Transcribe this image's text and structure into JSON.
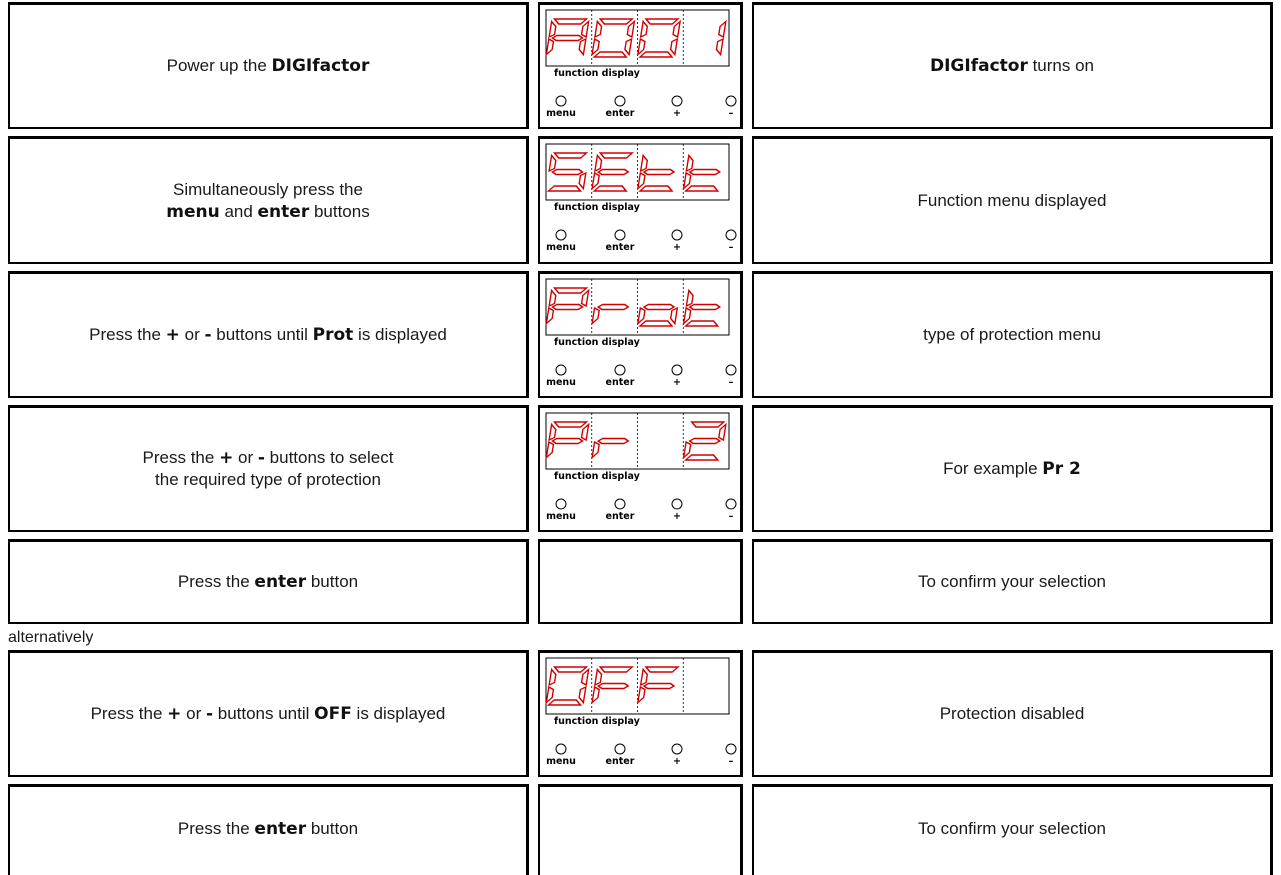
{
  "rows": [
    {
      "left": {
        "pre": "Power up the ",
        "b1": "DIGIfactor",
        "mid": "",
        "b2": "",
        "post": ""
      },
      "display": "A001",
      "right": {
        "pre": "",
        "b1": "DIGIfactor",
        "post": " turns on"
      }
    },
    {
      "left": {
        "pre": "Simultaneously press the",
        "b1": "menu",
        "mid": " and ",
        "b2": "enter",
        "post": " buttons"
      },
      "display": "SEtt",
      "right": {
        "pre": "Function menu displayed",
        "b1": "",
        "post": ""
      }
    },
    {
      "left": {
        "pre": "Press the ",
        "b1": "+",
        "mid": " or ",
        "b2": "-",
        "post": " buttons until ",
        "b3": "Prot",
        "post2": " is displayed"
      },
      "display": "Prot",
      "right": {
        "pre": "type of protection menu",
        "b1": "",
        "post": ""
      }
    },
    {
      "left": {
        "pre": "Press the ",
        "b1": "+",
        "mid": " or ",
        "b2": "-",
        "post": " buttons to select",
        "line2": "the required type of protection"
      },
      "display": "Pr 2",
      "right": {
        "pre": "For example ",
        "b1": "Pr 2",
        "post": ""
      }
    },
    {
      "left": {
        "pre": "Press the ",
        "b1": "enter",
        "post": " button"
      },
      "display": "",
      "right": {
        "pre": "To confirm your selection",
        "b1": "",
        "post": ""
      }
    },
    {
      "left": {
        "pre": "Press the ",
        "b1": "+",
        "mid": " or ",
        "b2": "-",
        "post": " buttons until ",
        "b3": "OFF",
        "post2": " is displayed"
      },
      "display": "OFF",
      "right": {
        "pre": "Protection disabled",
        "b1": "",
        "post": ""
      }
    },
    {
      "left": {
        "pre": "Press the ",
        "b1": "enter",
        "post": " button"
      },
      "display": "",
      "right": {
        "pre": "To confirm your selection",
        "b1": "",
        "post": ""
      }
    }
  ],
  "separator": "alternatively",
  "panel": {
    "function_display": "function display",
    "buttons": [
      "menu",
      "enter",
      "+",
      "–"
    ]
  },
  "colors": {
    "segment": "#d10000",
    "border": "#000000"
  }
}
